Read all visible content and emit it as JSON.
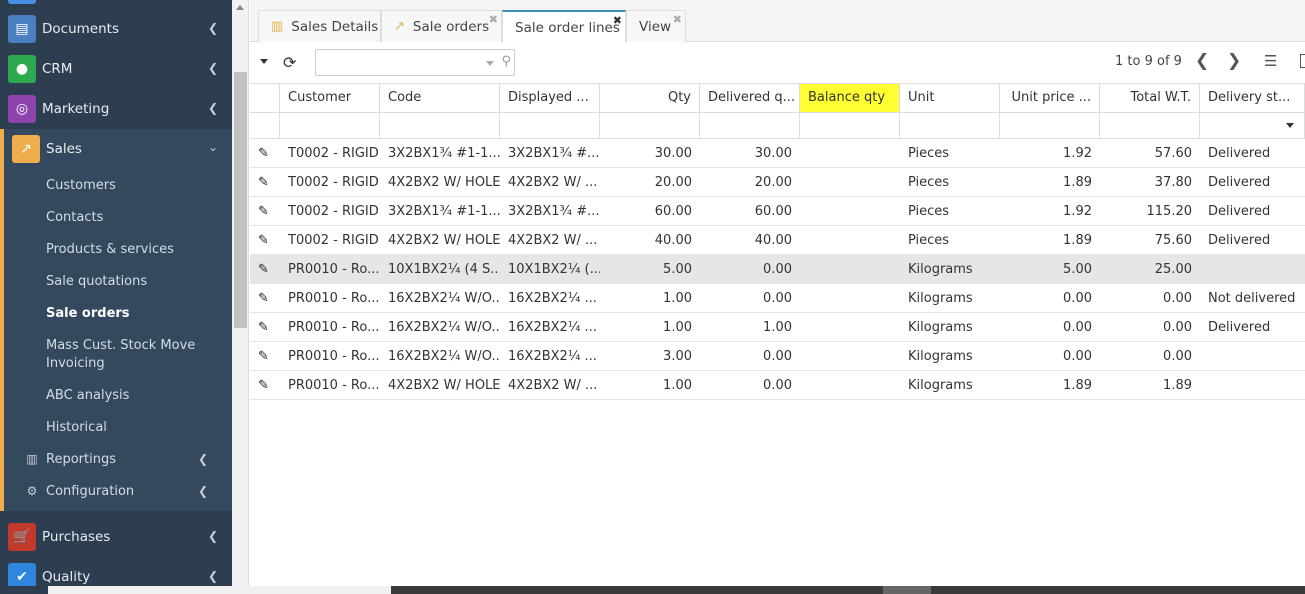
{
  "sidebar": {
    "top_items": [
      {
        "label": "Documents",
        "icon": "folder-icon",
        "color": "#4a7fc1"
      },
      {
        "label": "CRM",
        "icon": "user-icon",
        "color": "#2ea94f"
      },
      {
        "label": "Marketing",
        "icon": "target-icon",
        "color": "#8e44ad"
      }
    ],
    "sales": {
      "label": "Sales",
      "icon": "chart-line-icon",
      "color": "#f0ad4e"
    },
    "sales_sub": [
      {
        "label": "Customers"
      },
      {
        "label": "Contacts"
      },
      {
        "label": "Products & services"
      },
      {
        "label": "Sale quotations"
      },
      {
        "label": "Sale orders"
      },
      {
        "label": "Mass Cust. Stock Move Invoicing"
      },
      {
        "label": "ABC analysis"
      },
      {
        "label": "Historical"
      }
    ],
    "reportings": {
      "label": "Reportings",
      "icon": "bar-chart-icon"
    },
    "configuration": {
      "label": "Configuration",
      "icon": "gear-icon"
    },
    "bottom_items": [
      {
        "label": "Purchases",
        "icon": "cart-icon",
        "color": "#c0392b"
      },
      {
        "label": "Quality",
        "icon": "check-icon",
        "color": "#2e86de"
      }
    ]
  },
  "tabs": [
    {
      "label": "Sales Details",
      "icon": "bar-chart-icon"
    },
    {
      "label": "Sale orders",
      "icon": "line-chart-icon"
    },
    {
      "label": "Sale order lines"
    },
    {
      "label": "View"
    }
  ],
  "toolbar": {
    "search_value": "",
    "pager": "1 to 9 of 9"
  },
  "grid": {
    "columns": [
      "Customer",
      "Code",
      "Displayed ...",
      "Qty",
      "Delivered q...",
      "Balance qty",
      "Unit",
      "Unit price ...",
      "Total W.T.",
      "Delivery st..."
    ],
    "rows": [
      [
        "T0002 - RIGID",
        "3X2BX1¾ #1-1...",
        "3X2BX1¾ #...",
        "30.00",
        "30.00",
        "",
        "Pieces",
        "1.92",
        "57.60",
        "Delivered"
      ],
      [
        "T0002 - RIGID",
        "4X2BX2 W/ HOLE",
        "4X2BX2 W/ ...",
        "20.00",
        "20.00",
        "",
        "Pieces",
        "1.89",
        "37.80",
        "Delivered"
      ],
      [
        "T0002 - RIGID",
        "3X2BX1¾ #1-1...",
        "3X2BX1¾ #...",
        "60.00",
        "60.00",
        "",
        "Pieces",
        "1.92",
        "115.20",
        "Delivered"
      ],
      [
        "T0002 - RIGID",
        "4X2BX2 W/ HOLE",
        "4X2BX2 W/ ...",
        "40.00",
        "40.00",
        "",
        "Pieces",
        "1.89",
        "75.60",
        "Delivered"
      ],
      [
        "PR0010 - Ro...",
        "10X1BX2¼ (4 S...",
        "10X1BX2¼ (...",
        "5.00",
        "0.00",
        "",
        "Kilograms",
        "5.00",
        "25.00",
        ""
      ],
      [
        "PR0010 - Ro...",
        "16X2BX2¼ W/O...",
        "16X2BX2¼ ...",
        "1.00",
        "0.00",
        "",
        "Kilograms",
        "0.00",
        "0.00",
        "Not delivered"
      ],
      [
        "PR0010 - Ro...",
        "16X2BX2¼ W/O...",
        "16X2BX2¼ ...",
        "1.00",
        "1.00",
        "",
        "Kilograms",
        "0.00",
        "0.00",
        "Delivered"
      ],
      [
        "PR0010 - Ro...",
        "16X2BX2¼ W/O...",
        "16X2BX2¼ ...",
        "3.00",
        "0.00",
        "",
        "Kilograms",
        "0.00",
        "0.00",
        ""
      ],
      [
        "PR0010 - Ro...",
        "4X2BX2 W/ HOLE",
        "4X2BX2 W/ ...",
        "1.00",
        "0.00",
        "",
        "Kilograms",
        "1.89",
        "1.89",
        ""
      ]
    ],
    "selected_row": 4,
    "highlight_color": "#ffff33"
  }
}
